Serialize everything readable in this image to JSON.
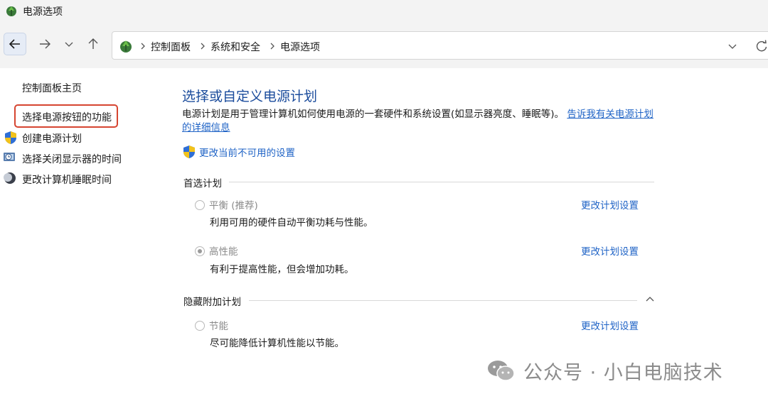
{
  "window": {
    "title": "电源选项",
    "icon": "power-options-icon"
  },
  "nav": {
    "back_icon": "arrow-left-icon",
    "forward_icon": "arrow-right-icon",
    "history_icon": "chevron-down-icon",
    "up_icon": "arrow-up-icon",
    "breadcrumbs": [
      "控制面板",
      "系统和安全",
      "电源选项"
    ],
    "address_dropdown_icon": "chevron-down-icon",
    "refresh_icon": "refresh-icon"
  },
  "sidebar": {
    "home_label": "控制面板主页",
    "items": [
      {
        "label": "选择电源按钮的功能",
        "icon": "",
        "highlighted": true
      },
      {
        "label": "创建电源计划",
        "icon": "uac-shield-icon"
      },
      {
        "label": "选择关闭显示器的时间",
        "icon": "monitor-clock-icon"
      },
      {
        "label": "更改计算机睡眠时间",
        "icon": "sleep-moon-icon"
      }
    ]
  },
  "main": {
    "title": "选择或自定义电源计划",
    "description": "电源计划是用于管理计算机如何使用电源的一套硬件和系统设置(如显示器亮度、睡眠等)。",
    "description_link": "告诉我有关电源计划的详细信息",
    "shield_link": "更改当前不可用的设置",
    "preferred_section": "首选计划",
    "hidden_section": "隐藏附加计划",
    "plans": [
      {
        "name": "平衡 (推荐)",
        "description": "利用可用的硬件自动平衡功耗与性能。",
        "selected": false,
        "link": "更改计划设置"
      },
      {
        "name": "高性能",
        "description": "有利于提高性能，但会增加功耗。",
        "selected": true,
        "link": "更改计划设置"
      },
      {
        "name": "节能",
        "description": "尽可能降低计算机性能以节能。",
        "selected": false,
        "link": "更改计划设置"
      }
    ]
  },
  "watermark": {
    "text": "公众号 · 小白电脑技术",
    "icon": "wechat-icon"
  },
  "colors": {
    "accent_title": "#1b4c9c",
    "link": "#1f63c6",
    "highlight_border": "#d64531",
    "chrome_bg": "#f3f3f3"
  }
}
